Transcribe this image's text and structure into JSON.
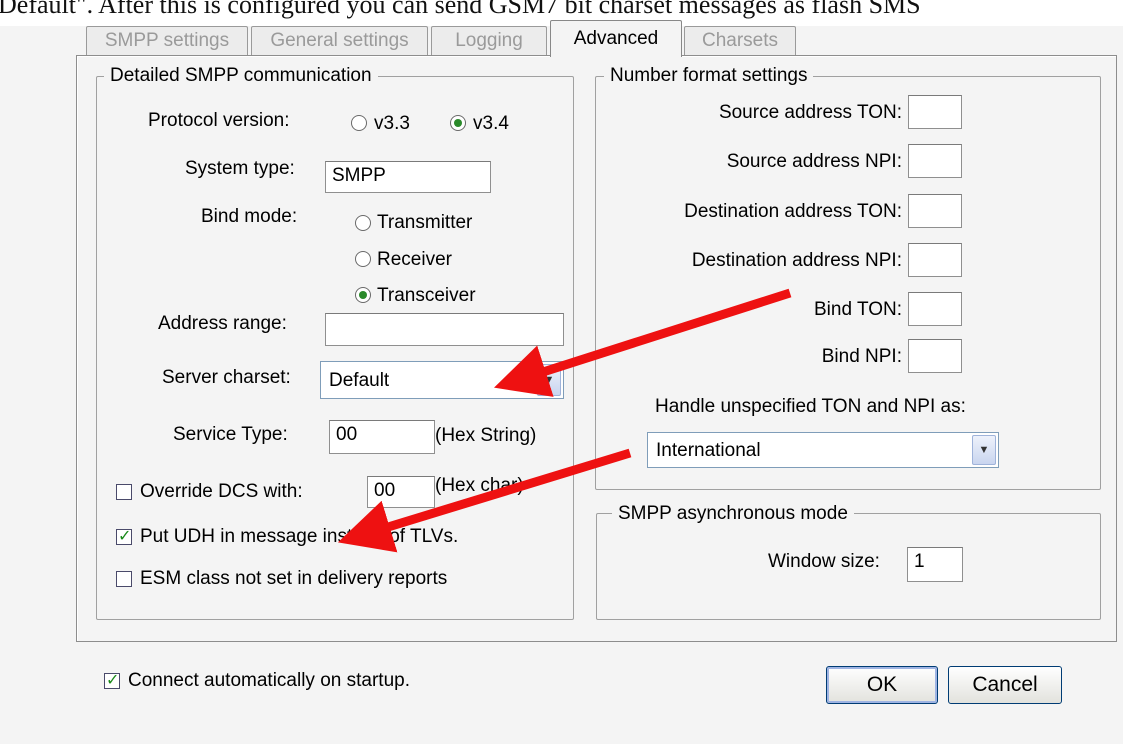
{
  "caption": "Default\". After this is configured you can send GSM7 bit charset messages as flash SMS",
  "tabs": [
    {
      "label": "SMPP settings",
      "active": false
    },
    {
      "label": "General settings",
      "active": false
    },
    {
      "label": "Logging",
      "active": false
    },
    {
      "label": "Advanced",
      "active": true
    },
    {
      "label": "Charsets",
      "active": false
    }
  ],
  "smpp": {
    "legend": "Detailed SMPP communication",
    "protocol_label": "Protocol version:",
    "protocol_options": [
      "v3.3",
      "v3.4"
    ],
    "protocol_selected": "v3.4",
    "system_type_label": "System type:",
    "system_type_value": "SMPP",
    "bind_mode_label": "Bind mode:",
    "bind_options": [
      "Transmitter",
      "Receiver",
      "Transceiver"
    ],
    "bind_selected": "Transceiver",
    "address_range_label": "Address range:",
    "address_range_value": "",
    "server_charset_label": "Server charset:",
    "server_charset_value": "Default",
    "service_type_label": "Service Type:",
    "service_type_value": "00",
    "service_type_hint": "(Hex String)",
    "override_dcs_label": "Override DCS with:",
    "override_dcs_checked": false,
    "override_dcs_value": "00",
    "override_dcs_hint": "(Hex char)",
    "put_udh_label": "Put UDH in message instead of TLVs.",
    "put_udh_checked": true,
    "esm_label": "ESM class not set in delivery reports",
    "esm_checked": false
  },
  "numfmt": {
    "legend": "Number format settings",
    "fields": [
      {
        "label": "Source address TON:",
        "value": ""
      },
      {
        "label": "Source address NPI:",
        "value": ""
      },
      {
        "label": "Destination address TON:",
        "value": ""
      },
      {
        "label": "Destination address NPI:",
        "value": ""
      },
      {
        "label": "Bind TON:",
        "value": ""
      },
      {
        "label": "Bind NPI:",
        "value": ""
      }
    ],
    "handle_label": "Handle unspecified TON and NPI as:",
    "handle_value": "International"
  },
  "async": {
    "legend": "SMPP asynchronous mode",
    "window_label": "Window size:",
    "window_value": "1"
  },
  "footer": {
    "autoconnect_label": "Connect automatically on startup.",
    "autoconnect_checked": true,
    "ok_label": "OK",
    "cancel_label": "Cancel"
  },
  "colors": {
    "annotation_arrow": "#ee1111",
    "radio_dot": "#2a8a2a"
  }
}
